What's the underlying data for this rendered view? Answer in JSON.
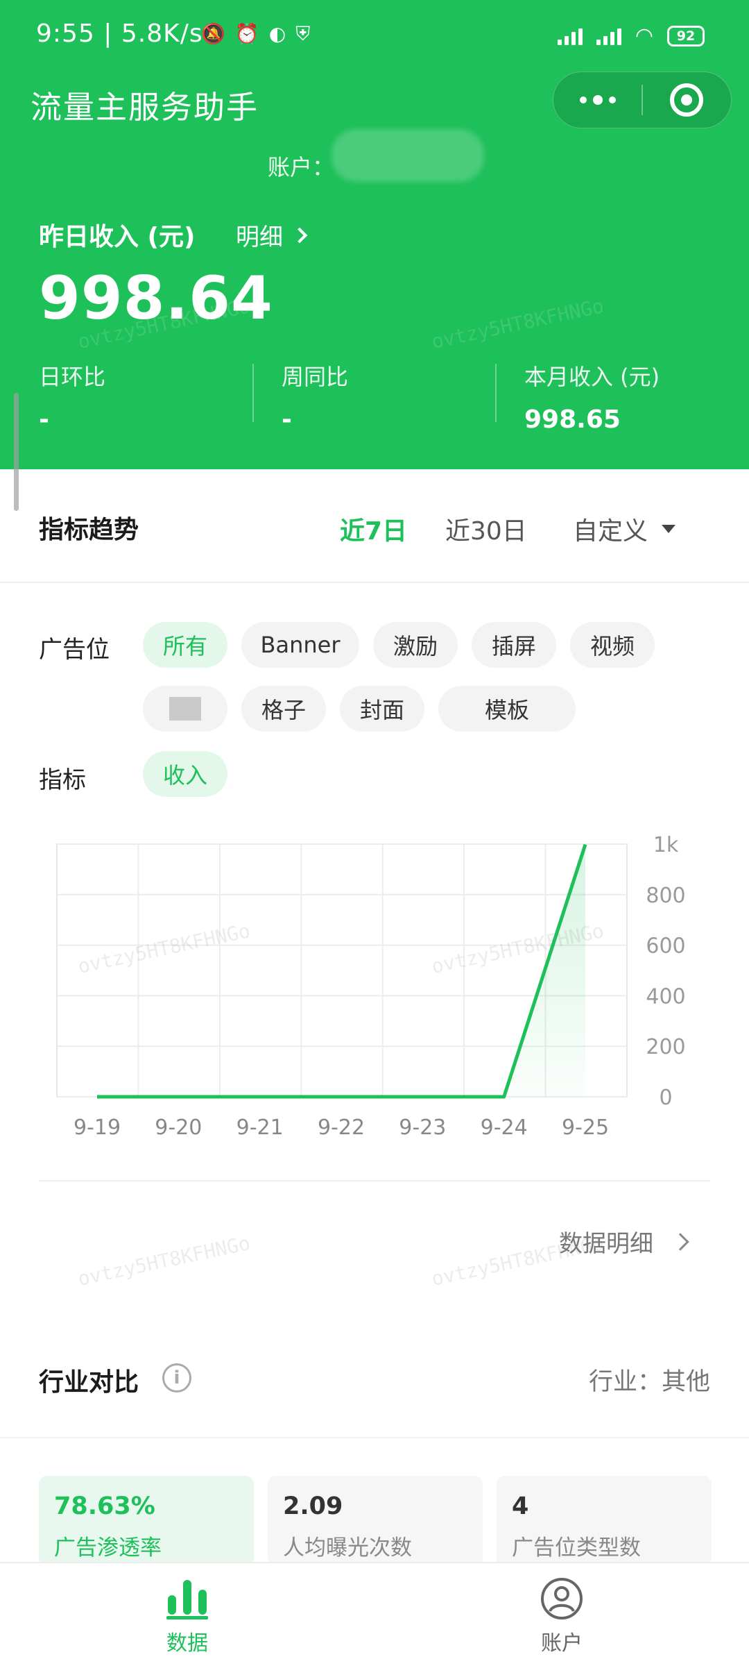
{
  "status_bar": {
    "time": "9:55",
    "network_speed": "5.8K/s",
    "battery": "92"
  },
  "header": {
    "title": "流量主服务助手",
    "account_label": "账户：",
    "income_title": "昨日收入 (元)",
    "detail_link": "明细",
    "income_value": "998.64",
    "metrics": [
      {
        "label": "日环比",
        "value": "-"
      },
      {
        "label": "周同比",
        "value": "-"
      },
      {
        "label": "本月收入 (元)",
        "value": "998.65"
      }
    ]
  },
  "trend": {
    "title": "指标趋势",
    "ranges": [
      "近7日",
      "近30日",
      "自定义"
    ],
    "active_range": "近7日",
    "ad_slot_label": "广告位",
    "ad_slots": [
      "所有",
      "Banner",
      "激励",
      "插屏",
      "视频",
      "",
      "格子",
      "封面",
      "模板"
    ],
    "metric_label": "指标",
    "metric_chip": "收入",
    "detail_link": "数据明细"
  },
  "chart_data": {
    "type": "line",
    "x": [
      "9-19",
      "9-20",
      "9-21",
      "9-22",
      "9-23",
      "9-24",
      "9-25"
    ],
    "series": [
      {
        "values": [
          0,
          0,
          0,
          0,
          0,
          0,
          998.64
        ]
      }
    ],
    "y_ticks": [
      "0",
      "200",
      "400",
      "600",
      "800",
      "1k"
    ],
    "ylim": [
      0,
      1000
    ],
    "grid": true,
    "color": "#1ec05a",
    "y_axis_side": "right"
  },
  "industry": {
    "title": "行业对比",
    "industry_value": "行业：其他",
    "stats": [
      {
        "value": "78.63%",
        "label": "广告渗透率"
      },
      {
        "value": "2.09",
        "label": "人均曝光次数"
      },
      {
        "value": "4",
        "label": "广告位类型数"
      }
    ]
  },
  "tabbar": {
    "items": [
      "数据",
      "账户"
    ],
    "active": "数据"
  },
  "colors": {
    "brand_green": "#1ec05a",
    "chip_active_bg": "#e4f7eb"
  },
  "watermark": "ovtzy5HT8KFHNGo\ntmJXkn88O3Cd8"
}
